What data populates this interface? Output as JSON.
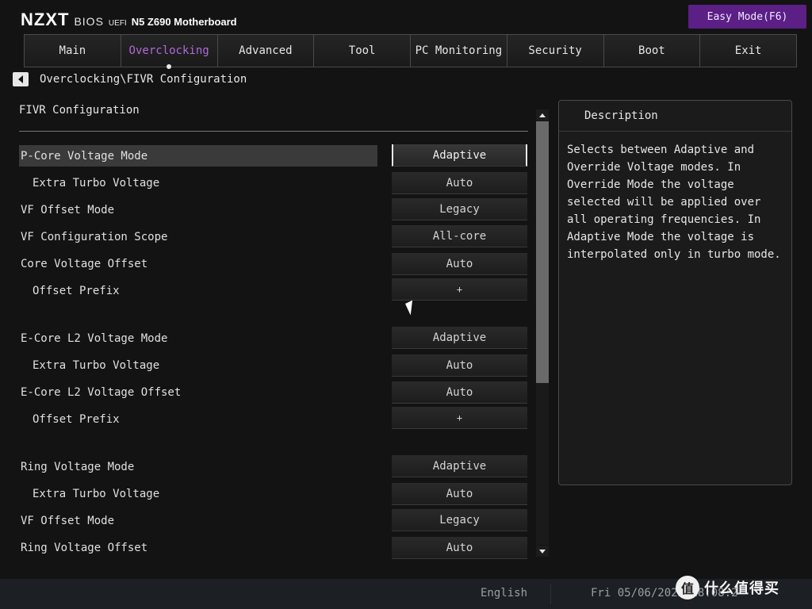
{
  "header": {
    "brand_logo": "NZXT",
    "brand_bios": "BIOS",
    "brand_uefi": "UEFI",
    "brand_model": "N5 Z690 Motherboard",
    "easy_mode_label": "Easy Mode(F6)"
  },
  "tabs": [
    {
      "label": "Main"
    },
    {
      "label": "Overclocking",
      "active": true
    },
    {
      "label": "Advanced"
    },
    {
      "label": "Tool"
    },
    {
      "label": "PC Monitoring"
    },
    {
      "label": "Security"
    },
    {
      "label": "Boot"
    },
    {
      "label": "Exit"
    }
  ],
  "breadcrumb": "Overclocking\\FIVR Configuration",
  "section": {
    "title": "FIVR Configuration"
  },
  "rows": [
    {
      "label": "P-Core Voltage Mode",
      "value": "Adaptive"
    },
    {
      "label": "Extra Turbo Voltage",
      "value": "Auto"
    },
    {
      "label": "VF Offset Mode",
      "value": "Legacy"
    },
    {
      "label": "VF Configuration Scope",
      "value": "All-core"
    },
    {
      "label": "Core Voltage Offset",
      "value": "Auto"
    },
    {
      "label": "Offset Prefix",
      "value": "+"
    },
    {
      "label": "E-Core L2 Voltage Mode",
      "value": "Adaptive"
    },
    {
      "label": "Extra Turbo Voltage",
      "value": "Auto"
    },
    {
      "label": "E-Core L2 Voltage Offset",
      "value": "Auto"
    },
    {
      "label": "Offset Prefix",
      "value": "+"
    },
    {
      "label": "Ring Voltage Mode",
      "value": "Adaptive"
    },
    {
      "label": "Extra Turbo Voltage",
      "value": "Auto"
    },
    {
      "label": "VF Offset Mode",
      "value": "Legacy"
    },
    {
      "label": "Ring Voltage Offset",
      "value": "Auto"
    }
  ],
  "description": {
    "title": "Description",
    "text": "Selects between Adaptive and Override Voltage modes. In Override Mode the voltage selected will be applied over all operating frequencies. In Adaptive Mode the voltage is interpolated only in turbo mode."
  },
  "footer": {
    "language": "English",
    "datetime": "Fri 05/06/2022 18:08:2"
  },
  "watermark": {
    "icon_char": "值",
    "text": "什么值得买"
  },
  "colors": {
    "accent": "#b06ad9",
    "accent_bg": "#5b1f86"
  }
}
